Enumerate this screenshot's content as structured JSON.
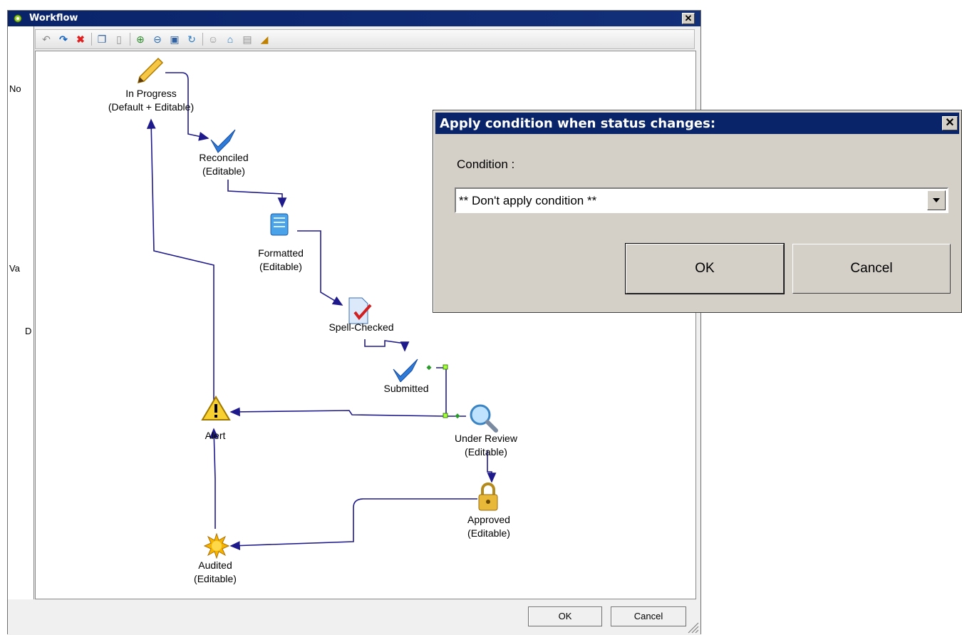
{
  "workflow_window": {
    "title": "Workflow",
    "left_strip_labels": [
      "No",
      "Va",
      "D"
    ],
    "ok_label": "OK",
    "cancel_label": "Cancel"
  },
  "toolbar": {
    "icons": [
      "undo-icon",
      "redo-icon",
      "delete-icon",
      "copy-icon",
      "paste-icon",
      "zoom-in-icon",
      "zoom-out-icon",
      "fit-icon",
      "refresh-icon",
      "user-icon",
      "home-icon",
      "lock-icon",
      "ruler-icon"
    ]
  },
  "nodes": [
    {
      "id": "in-progress",
      "line1": "In Progress",
      "line2": "(Default + Editable)",
      "icon": "pencil-icon"
    },
    {
      "id": "reconciled",
      "line1": "Reconciled",
      "line2": "(Editable)",
      "icon": "checkmark-icon"
    },
    {
      "id": "formatted",
      "line1": "Formatted",
      "line2": "(Editable)",
      "icon": "scroll-icon"
    },
    {
      "id": "spell-checked",
      "line1": "Spell-Checked",
      "line2": "",
      "icon": "document-check-icon"
    },
    {
      "id": "submitted",
      "line1": "Submitted",
      "line2": "",
      "icon": "checkmark-icon"
    },
    {
      "id": "under-review",
      "line1": "Under Review",
      "line2": "(Editable)",
      "icon": "magnifier-icon"
    },
    {
      "id": "approved",
      "line1": "Approved",
      "line2": "(Editable)",
      "icon": "padlock-icon"
    },
    {
      "id": "audited",
      "line1": "Audited",
      "line2": "(Editable)",
      "icon": "sun-icon"
    },
    {
      "id": "alert",
      "line1": "Alert",
      "line2": "",
      "icon": "warning-icon"
    }
  ],
  "dialog": {
    "title": "Apply condition when status changes:",
    "condition_label": "Condition :",
    "condition_value": "** Don't apply condition **",
    "ok_label": "OK",
    "cancel_label": "Cancel"
  },
  "colors": {
    "titlebar": "#0a246a",
    "edge": "#1f1a8c",
    "dialog_bg": "#d4d0c8"
  }
}
